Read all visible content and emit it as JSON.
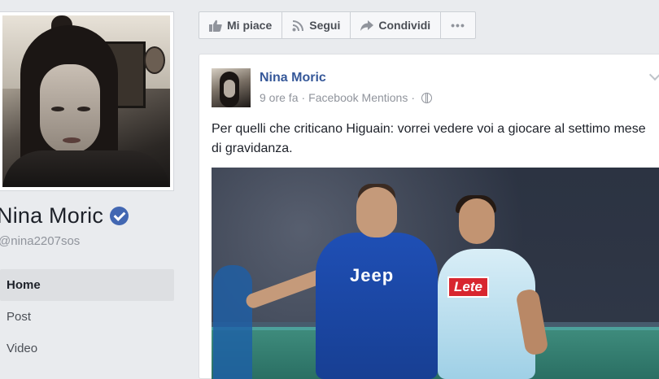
{
  "page": {
    "name": "Nina Moric",
    "handle": "@nina2207sos"
  },
  "nav": {
    "items": [
      {
        "label": "Home",
        "active": true
      },
      {
        "label": "Post",
        "active": false
      },
      {
        "label": "Video",
        "active": false
      }
    ]
  },
  "actions": {
    "like_label": "Mi piace",
    "follow_label": "Segui",
    "share_label": "Condividi",
    "more_label": "•••"
  },
  "post": {
    "author": "Nina Moric",
    "time": "9 ore fa",
    "separator": "·",
    "source": "Facebook Mentions",
    "text": "Per quelli che criticano Higuain: vorrei vedere voi a giocare al settimo mese di gravidanza.",
    "image_texts": {
      "sponsor_left": "Jeep",
      "sponsor_right": "Lete"
    }
  },
  "colors": {
    "background": "#e9ebee",
    "link": "#365899",
    "verified": "#4267b2"
  }
}
